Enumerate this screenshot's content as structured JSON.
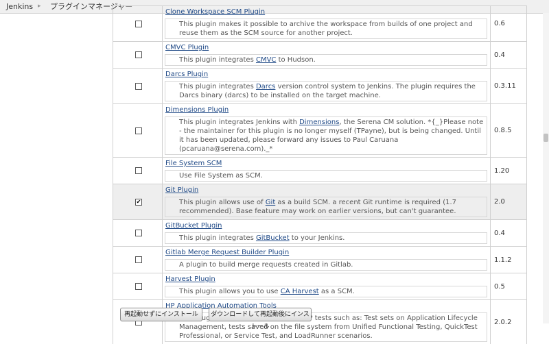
{
  "breadcrumb": {
    "items": [
      "Jenkins",
      "プラグインマネージャー"
    ],
    "separator": "▸"
  },
  "plugins": [
    {
      "name": "Clone Workspace SCM Plugin",
      "checked": false,
      "version": "0.6",
      "desc": [
        {
          "t": "This plugin makes it possible to archive the workspace from builds of one project and reuse them as the SCM source for another project."
        }
      ]
    },
    {
      "name": "CMVC Plugin",
      "checked": false,
      "version": "0.4",
      "desc": [
        {
          "t": "This plugin integrates "
        },
        {
          "t": "CMVC",
          "link": true
        },
        {
          "t": " to Hudson."
        }
      ]
    },
    {
      "name": "Darcs Plugin",
      "checked": false,
      "version": "0.3.11",
      "desc": [
        {
          "t": "This plugin integrates "
        },
        {
          "t": "Darcs",
          "link": true
        },
        {
          "t": " version control system to Jenkins. The plugin requires the Darcs binary (darcs) to be installed on the target machine."
        }
      ]
    },
    {
      "name": "Dimensions Plugin",
      "checked": false,
      "version": "0.8.5",
      "desc": [
        {
          "t": "This plugin integrates Jenkins with "
        },
        {
          "t": "Dimensions",
          "link": true
        },
        {
          "t": ", the Serena CM solution. *{_}Please note - the maintainer for this plugin is no longer myself (TPayne), but is being changed. Until it has been updated, please forward any issues to Paul Caruana (pcaruana@serena.com)._*"
        }
      ]
    },
    {
      "name": "File System SCM",
      "checked": false,
      "version": "1.20",
      "desc": [
        {
          "t": "Use File System as SCM."
        }
      ]
    },
    {
      "name": "Git Plugin",
      "checked": true,
      "version": "2.0",
      "desc": [
        {
          "t": "This plugin allows use of "
        },
        {
          "t": "Git",
          "link": true
        },
        {
          "t": " as a build SCM. a recent Git runtime is required (1.7 recommended). Base feature may work on earlier versions, but can't guarantee."
        }
      ]
    },
    {
      "name": "GitBucket Plugin",
      "checked": false,
      "version": "0.4",
      "desc": [
        {
          "t": "This plugin integrates "
        },
        {
          "t": "GitBucket",
          "link": true
        },
        {
          "t": " to your Jenkins."
        }
      ]
    },
    {
      "name": "Gitlab Merge Request Builder Plugin",
      "checked": false,
      "version": "1.1.2",
      "desc": [
        {
          "t": "A plugin to build merge requests created in Gitlab."
        }
      ]
    },
    {
      "name": "Harvest Plugin",
      "checked": false,
      "version": "0.5",
      "desc": [
        {
          "t": "This plugin allows you to use "
        },
        {
          "t": "CA Harvest",
          "link": true
        },
        {
          "t": " as a SCM."
        }
      ]
    },
    {
      "name": "HP Application Automation Tools",
      "checked": false,
      "version": "2.0.2",
      "desc": [
        {
          "t": "This plugin allows Jenkins to trigger HP tests such as: Test sets on Application Lifecycle Management, tests saved on the file system from Unified Functional Testing, QuickTest Professional, or Service Test, and LoadRunner scenarios."
        }
      ]
    }
  ],
  "buttons": {
    "install_without_restart": "再起動せずにインストール",
    "download_and_install_after_restart": "ダウンロードして再起動後にインストール"
  },
  "colors": {
    "link": "#204a87",
    "checked_row_bg": "#eeeeee",
    "border": "#cfcfcf"
  }
}
